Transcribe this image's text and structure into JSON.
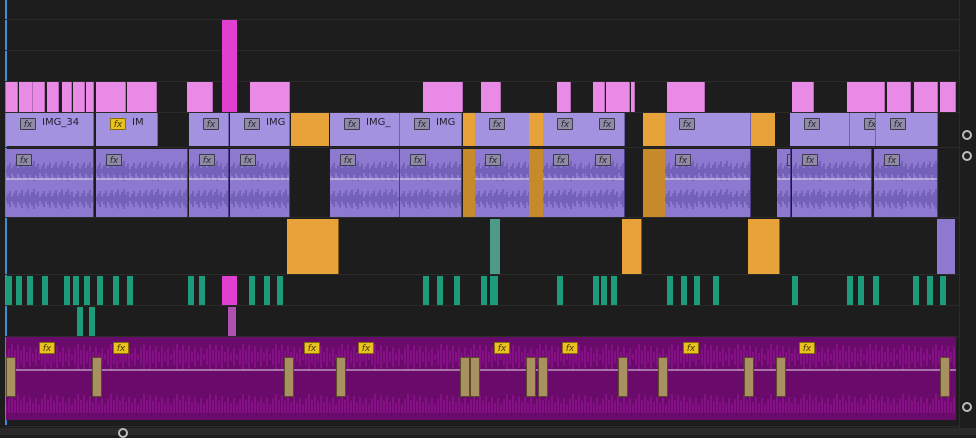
{
  "timeline": {
    "video_clip_labels": [
      "IMG_34",
      "IM",
      "IMG",
      "IMG_",
      "IMG"
    ],
    "fx_badge_text": "fx",
    "colors": {
      "background": "#1d1d1d",
      "pink_clip": "#e98be6",
      "magenta_clip": "#e040d0",
      "lavender_clip": "#a392e0",
      "orange_clip": "#e8a23a",
      "audio_waveform_bg": "#8d7ad0",
      "teal_clip": "#1d9c7c",
      "purple_audio": "#6a0b6c",
      "purple_audio_wave": "#a0169e",
      "tan_transition": "#a89060",
      "playhead": "#3d8fd8"
    }
  },
  "scrollbar": {
    "zoom_handle_icon": "circle-handle-icon"
  }
}
